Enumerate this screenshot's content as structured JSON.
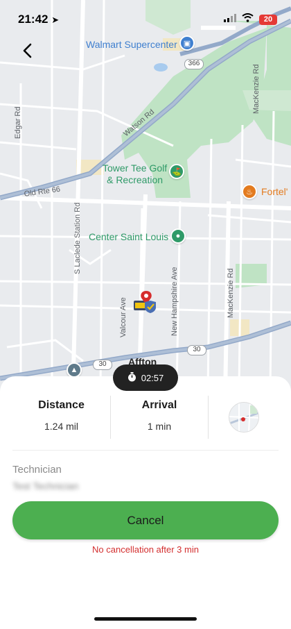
{
  "status_bar": {
    "time": "21:42",
    "battery": "20"
  },
  "map": {
    "pois": {
      "walmart": "Walmart Supercenter",
      "tower_tee": "Tower Tee Golf\n& Recreation",
      "fortel": "Fortel'",
      "center_saint_louis": "Center Saint Louis"
    },
    "streets": {
      "edgar_rd": "Edgar Rd",
      "watson_rd": "Watson Rd",
      "old_rte_66": "Old Rte 66",
      "s_laclede": "S Laclede Station Rd",
      "valcour": "Valcour Ave",
      "new_hampshire": "New Hampshire Ave",
      "mackenzie_bottom": "MacKenzie Rd",
      "mackenzie_top": "MacKenzie Rd"
    },
    "route_shields": {
      "r366": "366",
      "r30_right": "30",
      "r30_left": "30"
    },
    "town": "Affton"
  },
  "timer": {
    "value": "02:57"
  },
  "stats": {
    "distance_label": "Distance",
    "distance_value": "1.24 mil",
    "arrival_label": "Arrival",
    "arrival_value": "1 min"
  },
  "technician": {
    "label": "Technician",
    "name": "Test Technician"
  },
  "cancel_label": "Cancel",
  "notice": "No cancellation after 3 min",
  "colors": {
    "accent_green": "#4caf50",
    "warning_red": "#d32f2f",
    "park_green": "#bfe3c4",
    "highway_blue": "#93a9c9",
    "timer_dark": "#222222"
  }
}
